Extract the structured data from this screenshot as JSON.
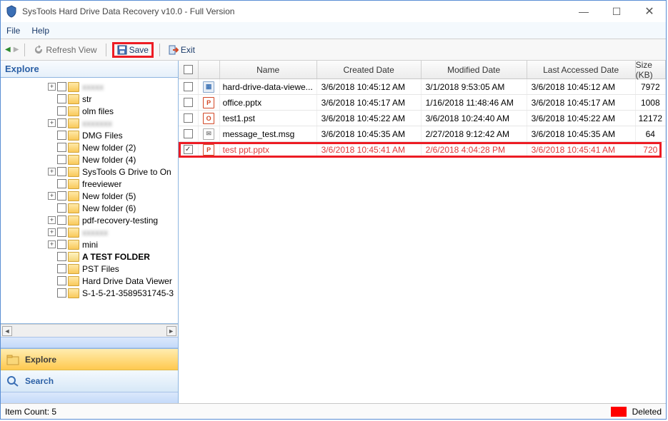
{
  "title": "SysTools Hard Drive Data Recovery v10.0 - Full Version",
  "menu": {
    "file": "File",
    "help": "Help"
  },
  "toolbar": {
    "refresh": "Refresh View",
    "save": "Save",
    "exit": "Exit"
  },
  "explore_header": "Explore",
  "tree": [
    {
      "indent": 60,
      "expander": "+",
      "label": "xxxxx",
      "blur": true,
      "icon": "folder"
    },
    {
      "indent": 60,
      "expander": "",
      "label": "str",
      "icon": "folder"
    },
    {
      "indent": 60,
      "expander": "",
      "label": "olm files",
      "icon": "folder"
    },
    {
      "indent": 60,
      "expander": "+",
      "label": "xxxxxxx",
      "blur": true,
      "icon": "folder"
    },
    {
      "indent": 60,
      "expander": "",
      "label": "DMG Files",
      "icon": "folder"
    },
    {
      "indent": 60,
      "expander": "",
      "label": "New folder (2)",
      "icon": "folder"
    },
    {
      "indent": 60,
      "expander": "",
      "label": "New folder (4)",
      "icon": "folder"
    },
    {
      "indent": 60,
      "expander": "+",
      "label": "SysTools G Drive to On",
      "icon": "folder"
    },
    {
      "indent": 60,
      "expander": "",
      "label": "freeviewer",
      "icon": "folder"
    },
    {
      "indent": 60,
      "expander": "+",
      "label": "New folder (5)",
      "icon": "folder"
    },
    {
      "indent": 60,
      "expander": "",
      "label": "New folder (6)",
      "icon": "folder"
    },
    {
      "indent": 60,
      "expander": "+",
      "label": "pdf-recovery-testing",
      "icon": "folder"
    },
    {
      "indent": 60,
      "expander": "+",
      "label": "xxxxxx",
      "blur": true,
      "icon": "folder"
    },
    {
      "indent": 60,
      "expander": "+",
      "label": "mini",
      "icon": "folder"
    },
    {
      "indent": 60,
      "expander": "",
      "label": "A TEST FOLDER",
      "icon": "special",
      "bold": true
    },
    {
      "indent": 60,
      "expander": "",
      "label": "PST Files",
      "icon": "folder"
    },
    {
      "indent": 60,
      "expander": "",
      "label": "Hard Drive Data Viewer",
      "icon": "folder"
    },
    {
      "indent": 60,
      "expander": "",
      "label": "S-1-5-21-3589531745-3",
      "icon": "folder"
    }
  ],
  "left_tabs": {
    "explore": "Explore",
    "search": "Search"
  },
  "columns": {
    "name": "Name",
    "created": "Created Date",
    "modified": "Modified Date",
    "accessed": "Last Accessed Date",
    "size": "Size (KB)"
  },
  "rows": [
    {
      "checked": false,
      "iconType": "generic",
      "name": "hard-drive-data-viewe...",
      "created": "3/6/2018 10:45:12 AM",
      "modified": "3/1/2018 9:53:05 AM",
      "accessed": "3/6/2018 10:45:12 AM",
      "size": "7972",
      "deleted": false
    },
    {
      "checked": false,
      "iconType": "pptx",
      "name": "office.pptx",
      "created": "3/6/2018 10:45:17 AM",
      "modified": "1/16/2018 11:48:46 AM",
      "accessed": "3/6/2018 10:45:17 AM",
      "size": "1008",
      "deleted": false
    },
    {
      "checked": false,
      "iconType": "pst",
      "name": "test1.pst",
      "created": "3/6/2018 10:45:22 AM",
      "modified": "3/6/2018 10:24:40 AM",
      "accessed": "3/6/2018 10:45:22 AM",
      "size": "12172",
      "deleted": false
    },
    {
      "checked": false,
      "iconType": "msg",
      "name": "message_test.msg",
      "created": "3/6/2018 10:45:35 AM",
      "modified": "2/27/2018 9:12:42 AM",
      "accessed": "3/6/2018 10:45:35 AM",
      "size": "64",
      "deleted": false
    },
    {
      "checked": true,
      "iconType": "pptx",
      "name": "test ppt.pptx",
      "created": "3/6/2018 10:45:41 AM",
      "modified": "2/6/2018 4:04:28 PM",
      "accessed": "3/6/2018 10:45:41 AM",
      "size": "720",
      "deleted": true
    }
  ],
  "status": {
    "count_label": "Item Count: 5",
    "legend": "Deleted"
  }
}
